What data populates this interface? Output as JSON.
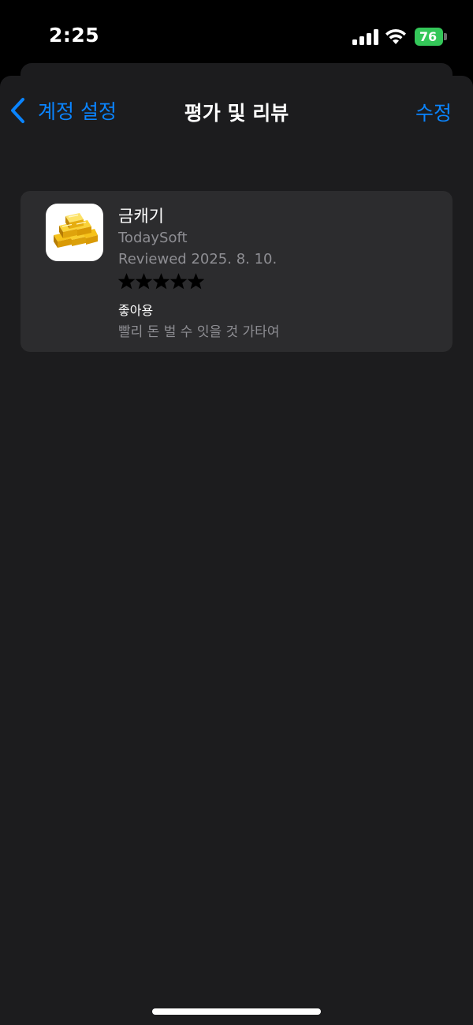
{
  "status_bar": {
    "time": "2:25",
    "battery_level": "76",
    "battery_color": "#34c759",
    "icons": [
      "signal-icon",
      "wifi-icon",
      "battery-icon"
    ]
  },
  "nav": {
    "back_label": "계정 설정",
    "title": "평가 및 리뷰",
    "edit_label": "수정",
    "accent_color": "#0a84ff"
  },
  "review": {
    "app_name": "금캐기",
    "developer": "TodaySoft",
    "date": "Reviewed 2025. 8. 10.",
    "rating": 5,
    "rating_max": 5,
    "title": "좋아용",
    "body": "빨리 돈 벌 수 잇을 것 가타여",
    "app_icon": "gold-bars-icon"
  }
}
